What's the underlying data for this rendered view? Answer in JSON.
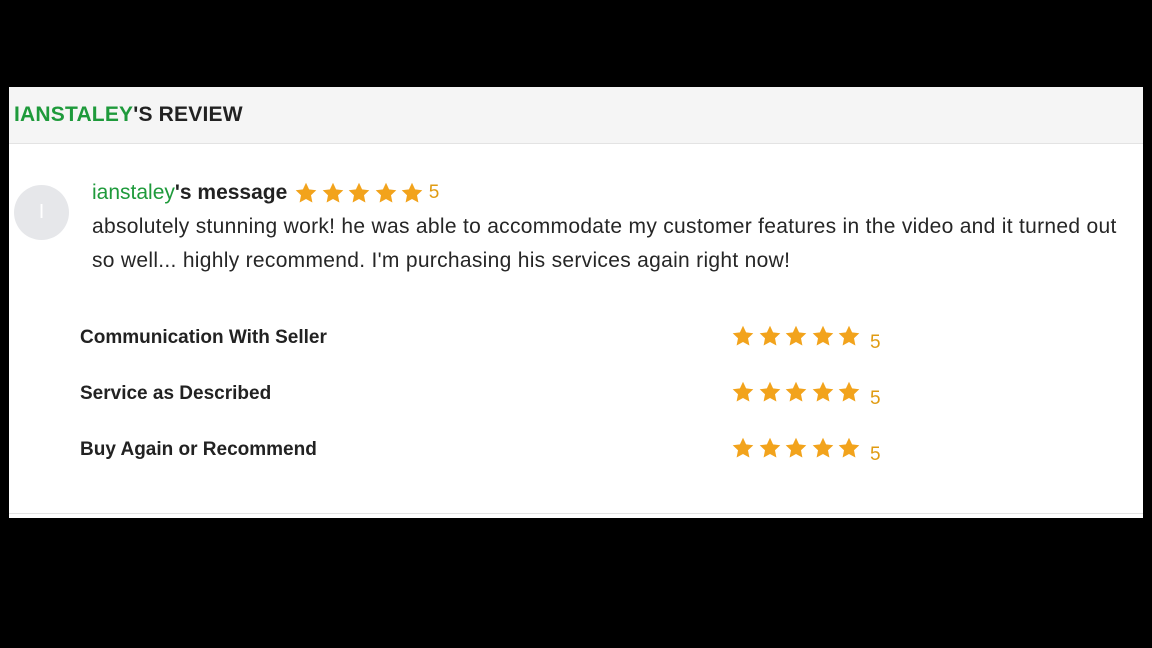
{
  "header": {
    "name": "IANSTALEY",
    "suffix": "'S REVIEW"
  },
  "reviewer": {
    "avatar_initial": "I",
    "name": "ianstaley",
    "message_suffix": "'s message",
    "rating": 5,
    "rating_text": "5"
  },
  "message": "absolutely stunning work! he was able to accommodate my customer features in the video and it turned out so well... highly recommend. I'm purchasing his services again right now!",
  "ratings": [
    {
      "label": "Communication With Seller",
      "score": 5,
      "score_text": "5"
    },
    {
      "label": "Service as Described",
      "score": 5,
      "score_text": "5"
    },
    {
      "label": "Buy Again or Recommend",
      "score": 5,
      "score_text": "5"
    }
  ],
  "colors": {
    "accent_green": "#1e9a3b",
    "star": "#f2a31c",
    "score": "#e09b12"
  },
  "icons": {
    "star": "star-icon"
  }
}
